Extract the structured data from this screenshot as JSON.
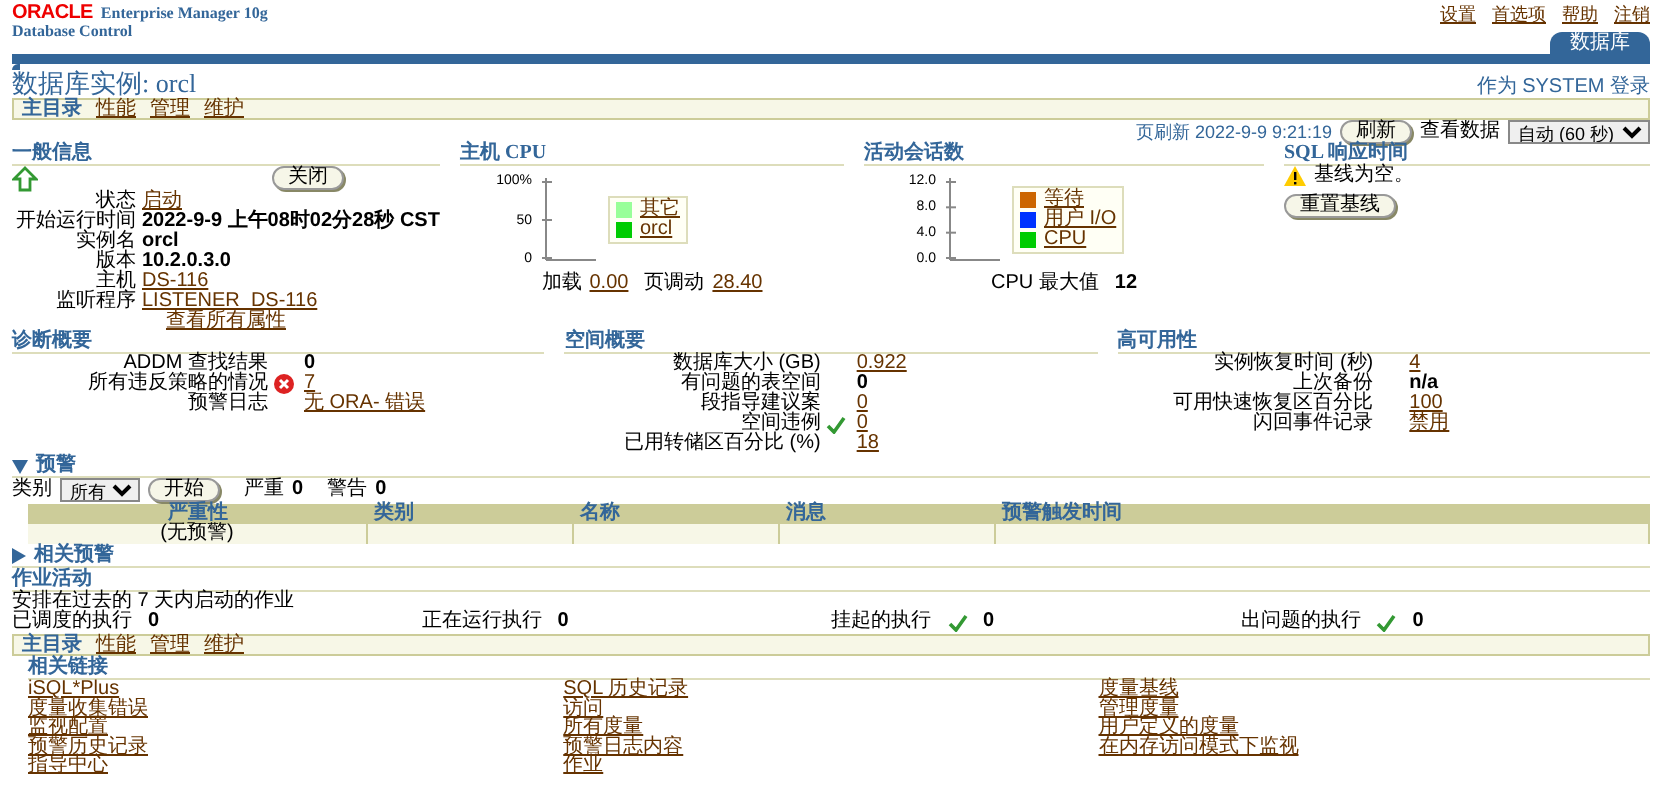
{
  "header": {
    "brand": "ORACLE",
    "product": "Enterprise Manager 10g",
    "subtitle": "Database Control",
    "global_links": [
      "设置",
      "首选项",
      "帮助",
      "注销"
    ],
    "tab": {
      "label": "数据库",
      "selected": true
    }
  },
  "login_as": "作为 SYSTEM 登录",
  "page_title": "数据库实例: orcl",
  "tabs": [
    {
      "label": "主目录",
      "selected": true
    },
    {
      "label": "性能",
      "selected": false
    },
    {
      "label": "管理",
      "selected": false
    },
    {
      "label": "维护",
      "selected": false
    }
  ],
  "refresh": {
    "label": "页刷新 2022-9-9 9:21:19",
    "button": "刷新",
    "view_label": "查看数据",
    "view_value": "自动 (60 秒)"
  },
  "general": {
    "title": "一般信息",
    "status_up": true,
    "button": "关闭",
    "fields": [
      {
        "label": "状态",
        "value": "启动",
        "link": true
      },
      {
        "label": "开始运行时间",
        "value": "2022-9-9 上午08时02分28秒 CST",
        "link": false
      },
      {
        "label": "实例名",
        "value": "orcl",
        "link": false
      },
      {
        "label": "版本",
        "value": "10.2.0.3.0",
        "link": false
      },
      {
        "label": "主机",
        "value": "DS-116",
        "link": true
      },
      {
        "label": "监听程序",
        "value": "LISTENER_DS-116",
        "link": true
      }
    ],
    "link": "查看所有属性"
  },
  "host_cpu": {
    "title": "主机 CPU",
    "yticks": [
      "100%",
      "50",
      "0"
    ],
    "legend": [
      {
        "label": "其它",
        "color": "#99ff99"
      },
      {
        "label": "orcl",
        "color": "#00cc00"
      }
    ],
    "stats": [
      {
        "label": "加载",
        "value": "0.00"
      },
      {
        "label": "页调动",
        "value": "28.40"
      }
    ]
  },
  "active_sessions": {
    "title": "活动会话数",
    "yticks": [
      "12.0",
      "8.0",
      "4.0",
      "0.0"
    ],
    "legend": [
      {
        "label": "等待",
        "color": "#cc6600"
      },
      {
        "label": "用户 I/O",
        "color": "#0033ff"
      },
      {
        "label": "CPU",
        "color": "#00cc00"
      }
    ],
    "footer_label": "CPU 最大值",
    "footer_value": "12"
  },
  "sql_response": {
    "title": "SQL 响应时间",
    "warning": "基线为空。",
    "button": "重置基线"
  },
  "summaries": [
    {
      "title": "诊断概要",
      "rows": [
        {
          "label": "ADDM 查找结果",
          "value": "0",
          "link": false
        },
        {
          "label": "所有违反策略的情况",
          "value": "7",
          "link": true,
          "kind": "error"
        },
        {
          "label": "预警日志",
          "value": "无 ORA- 错误",
          "link": true
        }
      ]
    },
    {
      "title": "空间概要",
      "rows": [
        {
          "label": "数据库大小 (GB)",
          "value": "0.922",
          "link": true
        },
        {
          "label": "有问题的表空间",
          "value": "0",
          "link": false
        },
        {
          "label": "段指导建议案",
          "value": "0",
          "link": true
        },
        {
          "label": "空间违例",
          "value": "0",
          "link": true,
          "kind": "ok"
        },
        {
          "label": "已用转储区百分比 (%)",
          "value": "18",
          "link": true
        }
      ]
    },
    {
      "title": "高可用性",
      "rows": [
        {
          "label": "实例恢复时间 (秒)",
          "value": "4",
          "link": true
        },
        {
          "label": "上次备份",
          "value": "n/a",
          "link": false
        },
        {
          "label": "可用快速恢复区百分比",
          "value": "100",
          "link": true
        },
        {
          "label": "闪回事件记录",
          "value": "禁用",
          "link": true
        }
      ]
    }
  ],
  "alerts": {
    "title": "预警",
    "expanded": true,
    "filter_label": "类别",
    "filter_value": "所有",
    "go_button": "开始",
    "counts": [
      {
        "label": "严重",
        "value": "0"
      },
      {
        "label": "警告",
        "value": "0"
      }
    ],
    "columns": [
      "严重性",
      "类别",
      "名称",
      "消息",
      "预警触发时间"
    ],
    "empty": "(无预警)"
  },
  "related_alerts": {
    "title": "相关预警",
    "expanded": false
  },
  "jobs": {
    "title": "作业活动",
    "note": "安排在过去的 7 天内启动的作业",
    "stats": [
      {
        "label": "已调度的执行",
        "value": "0",
        "check": false
      },
      {
        "label": "正在运行执行",
        "value": "0",
        "check": false
      },
      {
        "label": "挂起的执行",
        "value": "0",
        "check": true
      },
      {
        "label": "出问题的执行",
        "value": "0",
        "check": true
      }
    ]
  },
  "bottom_tabs": [
    {
      "label": "主目录",
      "selected": true
    },
    {
      "label": "性能",
      "selected": false
    },
    {
      "label": "管理",
      "selected": false
    },
    {
      "label": "维护",
      "selected": false
    }
  ],
  "related_links": {
    "title": "相关链接",
    "columns": [
      [
        "iSQL*Plus",
        "度量收集错误",
        "监视配置",
        "预警历史记录",
        "指导中心"
      ],
      [
        "SQL 历史记录",
        "访问",
        "所有度量",
        "预警日志内容",
        "作业"
      ],
      [
        "度量基线",
        "管理度量",
        "用户定义的度量",
        "在内存访问模式下监视"
      ]
    ]
  }
}
